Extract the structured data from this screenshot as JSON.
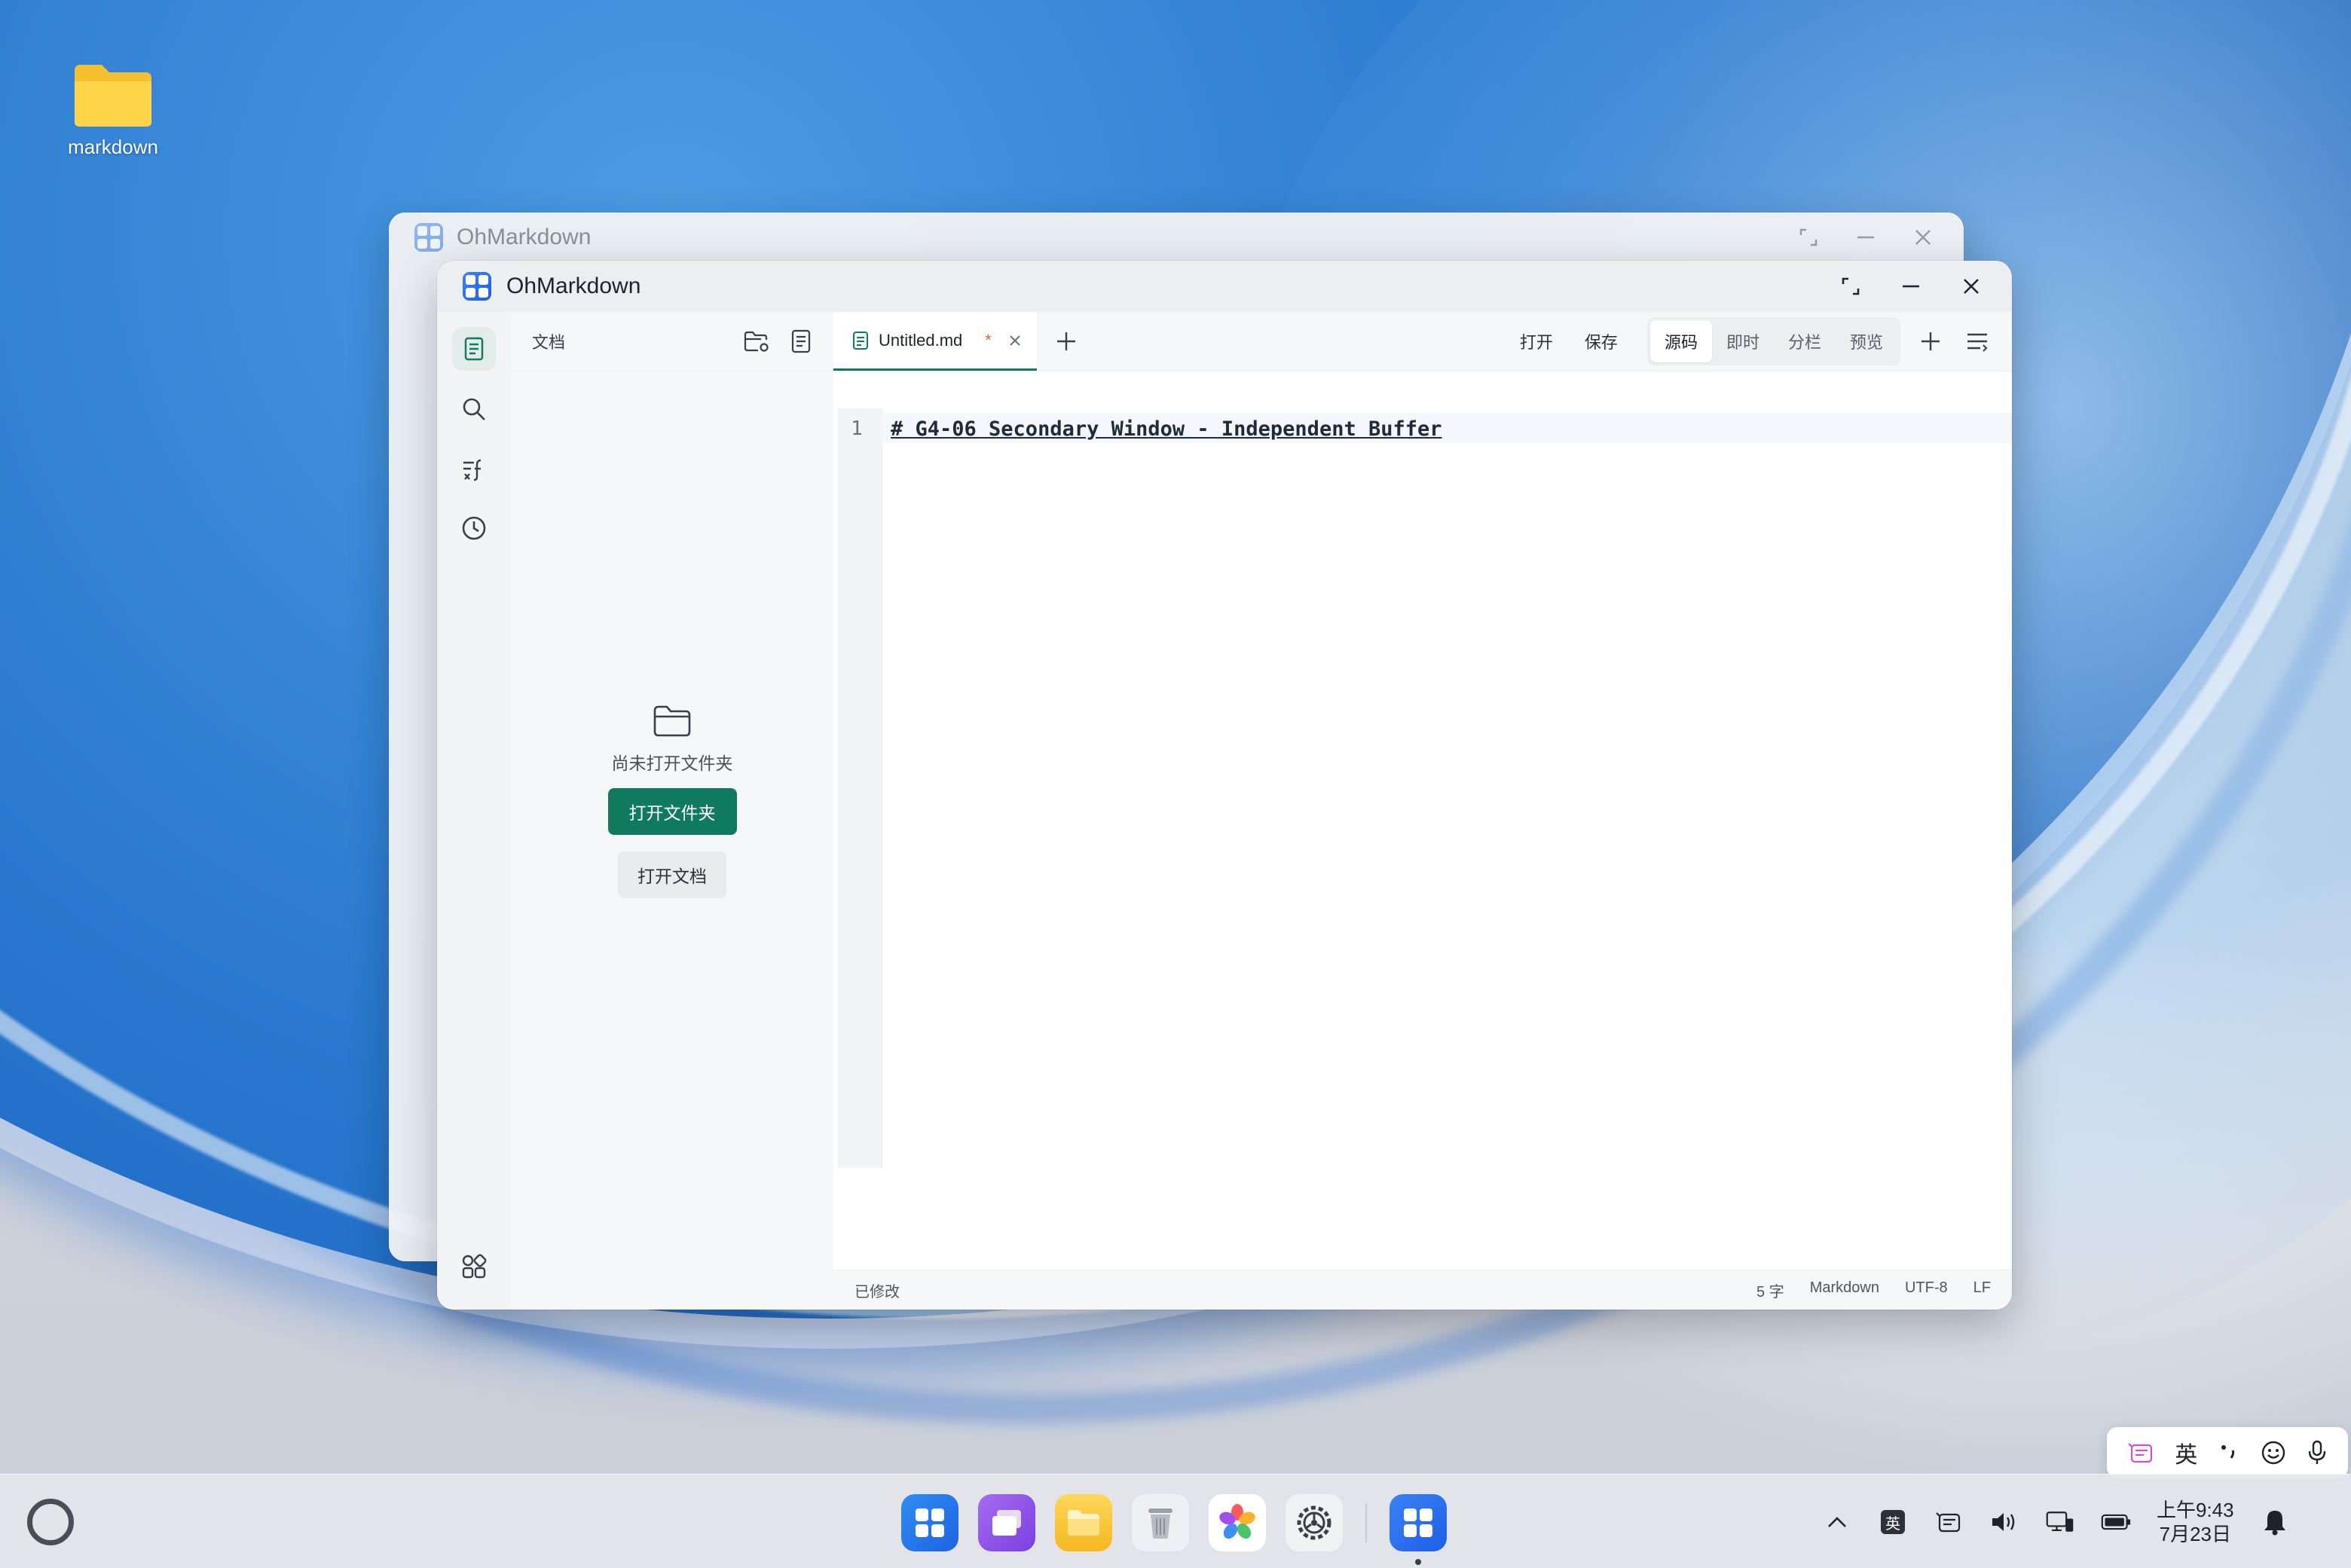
{
  "desktop": {
    "folder_label": "markdown"
  },
  "background_window": {
    "title": "OhMarkdown"
  },
  "window": {
    "title": "OhMarkdown"
  },
  "explorer": {
    "header_label": "文档",
    "empty_text": "尚未打开文件夹",
    "open_folder_button": "打开文件夹",
    "open_document_button": "打开文档"
  },
  "tabs": [
    {
      "name": "Untitled.md",
      "dirty_marker": "*"
    }
  ],
  "toolbar": {
    "open_label": "打开",
    "save_label": "保存",
    "modes": [
      "源码",
      "即时",
      "分栏",
      "预览"
    ],
    "active_mode": "源码"
  },
  "editor": {
    "lines": [
      {
        "number": "1",
        "text": "# G4-06 Secondary Window - Independent Buffer"
      }
    ]
  },
  "statusbar": {
    "state": "已修改",
    "word_count": "5 字",
    "language": "Markdown",
    "encoding": "UTF-8",
    "line_ending": "LF"
  },
  "ime": {
    "language": "英"
  },
  "taskbar": {
    "ime_indicator": "英",
    "time": "上午9:43",
    "date": "7月23日"
  },
  "colors": {
    "accent": "#0f7a5c",
    "dirty": "#e06a2b",
    "app_logo": "#1d5ee8"
  }
}
